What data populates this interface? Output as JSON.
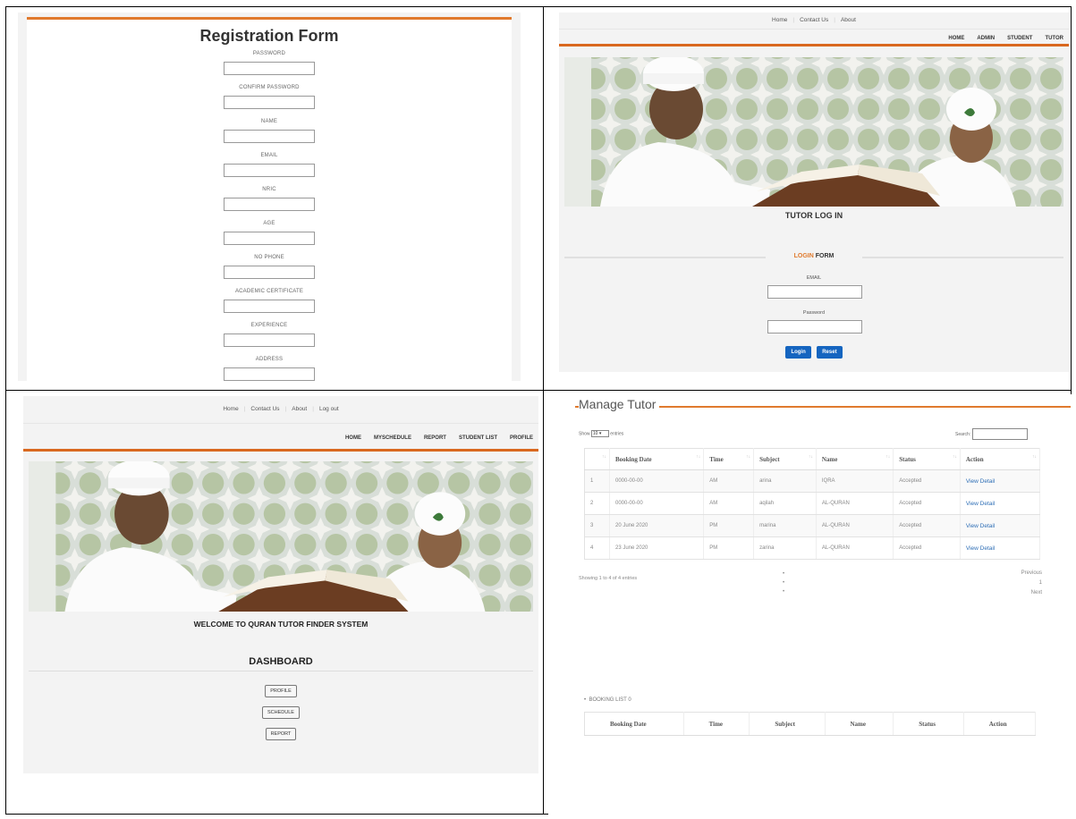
{
  "registration": {
    "title": "Registration Form",
    "fields": [
      "PASSWORD",
      "CONFIRM PASSWORD",
      "NAME",
      "EMAIL",
      "NRIC",
      "AGE",
      "NO PHONE",
      "ACADEMIC CERTIFICATE",
      "EXPERIENCE",
      "ADDRESS"
    ]
  },
  "login": {
    "topnav": [
      "Home",
      "Contact Us",
      "About"
    ],
    "mainnav": [
      "HOME",
      "ADMIN",
      "STUDENT",
      "TUTOR"
    ],
    "title": "TUTOR LOG IN",
    "form_head_accent": "LOGIN",
    "form_head_rest": "FORM",
    "email_label": "EMAIL",
    "password_label": "Password",
    "login_button": "Login",
    "reset_button": "Reset"
  },
  "dashboard": {
    "topnav": [
      "Home",
      "Contact Us",
      "About",
      "Log out"
    ],
    "mainnav": [
      "HOME",
      "MYSCHEDULE",
      "REPORT",
      "STUDENT LIST",
      "PROFILE"
    ],
    "welcome": "WELCOME TO QURAN TUTOR FINDER SYSTEM",
    "title": "DASHBOARD",
    "buttons": [
      "PROFILE",
      "SCHEDULE",
      "REPORT"
    ]
  },
  "manage": {
    "title": "Manage Tutor",
    "show_prefix": "Show",
    "show_value": "10",
    "show_suffix": "entries",
    "search_label": "Search:",
    "columns": [
      "Booking Date",
      "Time",
      "Subject",
      "Name",
      "Status",
      "Action"
    ],
    "rows": [
      {
        "no": "1",
        "date": "0000-00-00",
        "time": "AM",
        "subject": "arina",
        "name": "IQRA",
        "status": "Accepted",
        "action": "View Detail"
      },
      {
        "no": "2",
        "date": "0000-00-00",
        "time": "AM",
        "subject": "aqilah",
        "name": "AL-QURAN",
        "status": "Accepted",
        "action": "View Detail"
      },
      {
        "no": "3",
        "date": "20 June 2020",
        "time": "PM",
        "subject": "marina",
        "name": "AL-QURAN",
        "status": "Accepted",
        "action": "View Detail"
      },
      {
        "no": "4",
        "date": "23 June 2020",
        "time": "PM",
        "subject": "zarina",
        "name": "AL-QURAN",
        "status": "Accepted",
        "action": "View Detail"
      }
    ],
    "info": "Showing 1 to 4 of 4 entries",
    "pager": [
      "Previous",
      "1",
      "Next"
    ],
    "booking_list": "BOOKING LIST 0",
    "booking_columns": [
      "Booking Date",
      "Time",
      "Subject",
      "Name",
      "Status",
      "Action"
    ]
  }
}
